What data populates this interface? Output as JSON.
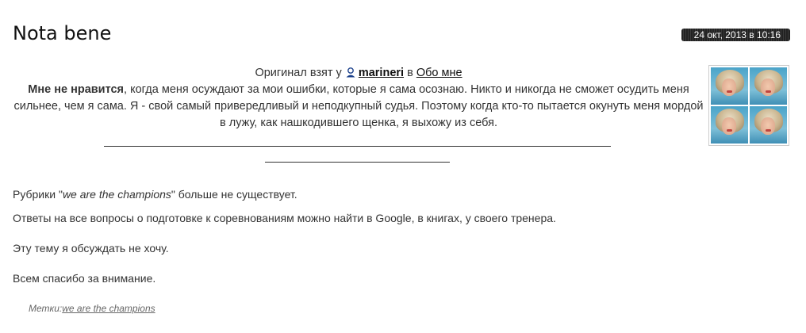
{
  "post": {
    "title": "Nota bene",
    "date": "24 окт, 2013 в 10:16"
  },
  "quote": {
    "prefix": "Оригинал взят у",
    "user": "marineri",
    "in": "в",
    "source": "Обо мне",
    "bold": "Мне не нравится",
    "body": ", когда меня осуждают за мои ошибки, которые я сама осознаю. Никто и никогда не сможет осудить меня сильнее, чем я сама. Я - свой самый привередливый и неподкупный судья. Поэтому когда кто-то пытается окунуть меня мордой в лужу, как нашкодившего щенка, я выхожу из себя."
  },
  "body": {
    "p1_start": "Рубрики \"",
    "p1_italic": "we are the champions",
    "p1_end": "\" больше не существует.",
    "p2": "Ответы на все вопросы о подготовке к соревнованиям можно найти в Google, в книгах, у своего тренера.",
    "p3": "Эту тему я обсуждать не хочу.",
    "p4": "Всем спасибо за внимание."
  },
  "tags": {
    "label": "Метки:",
    "items": [
      "we are the champions"
    ]
  }
}
